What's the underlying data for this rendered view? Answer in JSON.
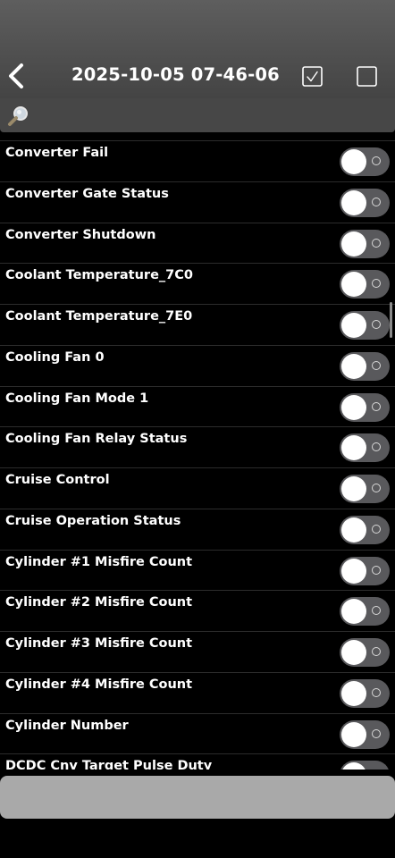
{
  "header": {
    "title": "2025-10-05 07-46-06",
    "back_icon": "chevron-left-icon",
    "select_all_icon": "checked-box-icon",
    "select_none_icon": "empty-box-icon"
  },
  "search": {
    "icon": "magnifier-icon",
    "value": "",
    "placeholder": ""
  },
  "list": {
    "items": [
      {
        "label": "Converter Fail",
        "enabled": false
      },
      {
        "label": "Converter Gate Status",
        "enabled": false
      },
      {
        "label": "Converter Shutdown",
        "enabled": false
      },
      {
        "label": "Coolant Temperature_7C0",
        "enabled": false
      },
      {
        "label": "Coolant Temperature_7E0",
        "enabled": false
      },
      {
        "label": "Cooling Fan 0",
        "enabled": false
      },
      {
        "label": "Cooling Fan Mode 1",
        "enabled": false
      },
      {
        "label": "Cooling Fan Relay Status",
        "enabled": false
      },
      {
        "label": "Cruise Control",
        "enabled": false
      },
      {
        "label": "Cruise Operation Status",
        "enabled": false
      },
      {
        "label": "Cylinder #1 Misfire Count",
        "enabled": false
      },
      {
        "label": "Cylinder #2 Misfire Count",
        "enabled": false
      },
      {
        "label": "Cylinder #3 Misfire Count",
        "enabled": false
      },
      {
        "label": "Cylinder #4 Misfire Count",
        "enabled": false
      },
      {
        "label": "Cylinder Number",
        "enabled": false
      },
      {
        "label": "DCDC Cnv Target Pulse Duty",
        "enabled": false
      }
    ]
  },
  "action_button": {
    "label": ""
  },
  "colors": {
    "background": "#000000",
    "header": "#4f4f4f",
    "search_bar": "#474747",
    "toggle_track_off": "#59595c",
    "action_button": "#a9a9a9"
  }
}
